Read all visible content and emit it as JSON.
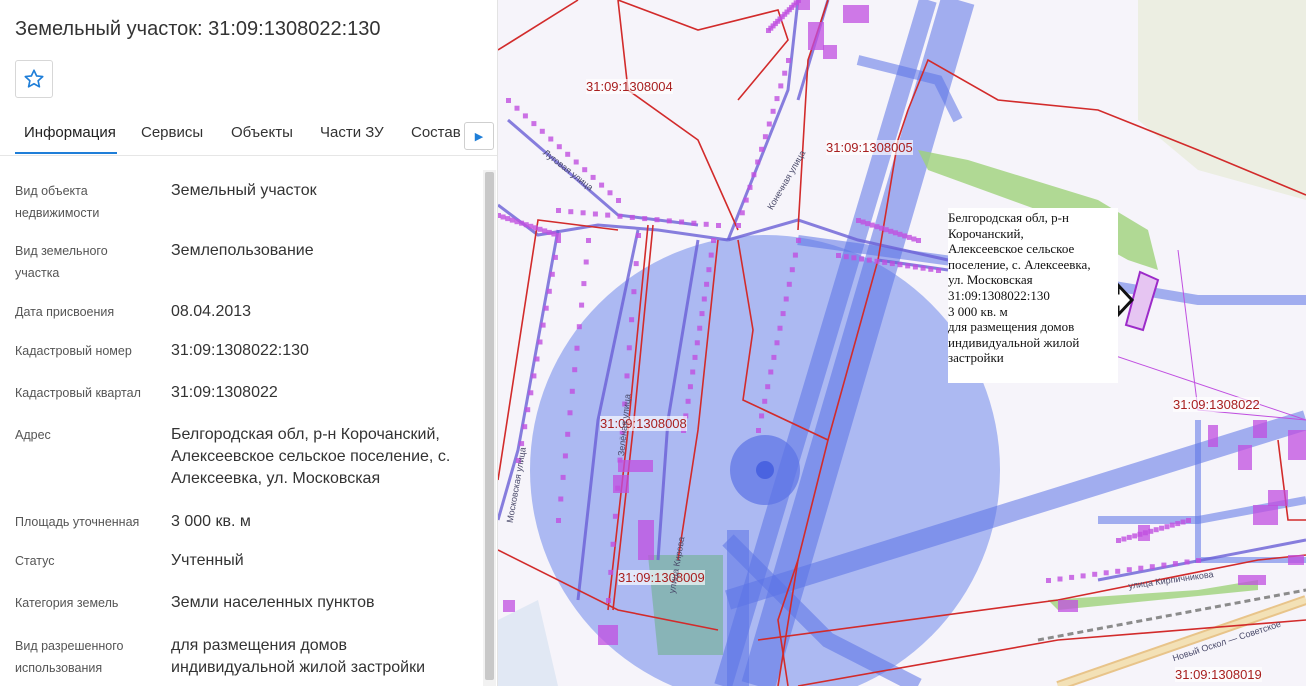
{
  "panel": {
    "title": "Земельный участок: 31:09:1308022:130",
    "tabs": [
      "Информация",
      "Сервисы",
      "Объекты",
      "Части ЗУ",
      "Состав"
    ],
    "rows": [
      {
        "label": "Вид объекта недвижимости",
        "value": "Земельный участок"
      },
      {
        "label": "Вид земельного участка",
        "value": "Землепользование"
      },
      {
        "label": "Дата присвоения",
        "value": "08.04.2013"
      },
      {
        "label": "Кадастровый номер",
        "value": "31:09:1308022:130"
      },
      {
        "label": "Кадастровый квартал",
        "value": "31:09:1308022"
      },
      {
        "label": "Адрес",
        "value": "Белгородская обл, р-н Корочанский, Алексеевское сельское поселение, с. Алексеевка, ул. Московская"
      },
      {
        "label": "Площадь уточненная",
        "value": "3 000 кв. м"
      },
      {
        "label": "Статус",
        "value": "Учтенный"
      },
      {
        "label": "Категория земель",
        "value": "Земли населенных пунктов"
      },
      {
        "label": "Вид разрешенного использования",
        "value": "для размещения домов индивидуальной жилой застройки"
      }
    ]
  },
  "map": {
    "quarter_labels": [
      "31:09:1308004",
      "31:09:1308005",
      "31:09:1308008",
      "31:09:1308009",
      "31:09:1308022",
      "31:09:1308019"
    ],
    "street_labels": [
      "Луговая улица",
      "Конечная улица",
      "Зелёная улица",
      "Московская улица",
      "улица Кирова",
      "улица Кирпичникова",
      "Новый Оскол — Советское"
    ],
    "popup_lines": [
      "Белгородская обл, р-н",
      "Корочанский,",
      "Алексеевское сельское",
      "поселение, с. Алексеевка,",
      "ул. Московская",
      "31:09:1308022:130",
      "3 000 кв. м",
      "для размещения домов",
      "индивидуальной жилой",
      "застройки"
    ]
  },
  "icons": {
    "favorite": "star-outline-icon",
    "tabs_next": "chevron-right-icon",
    "map_pointer": "arrow-right-icon"
  },
  "colors": {
    "accent": "#1f7ed8",
    "quarter_border": "#d22b2b",
    "overlay_blue": "#5b72e6",
    "parcel": "#c04fe0"
  }
}
